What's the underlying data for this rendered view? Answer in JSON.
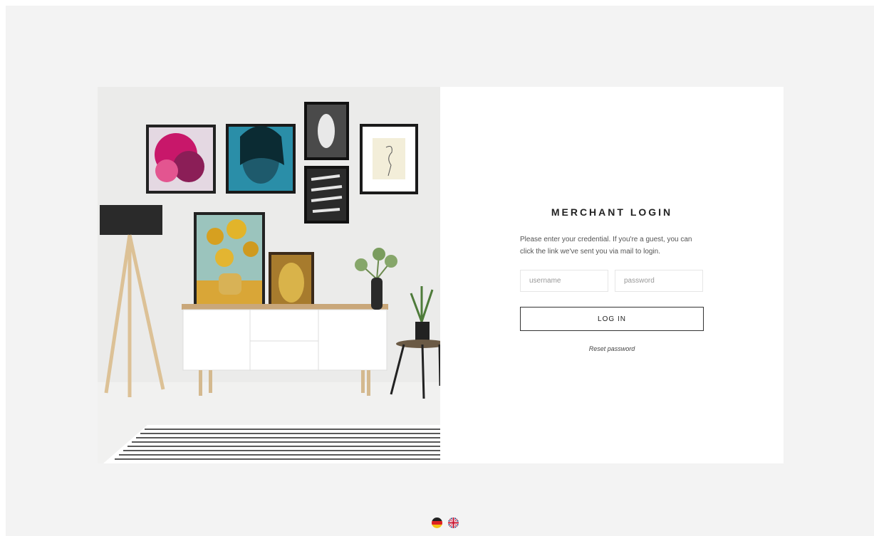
{
  "login": {
    "title": "MERCHANT LOGIN",
    "description": "Please enter your credential. If you're a guest, you can click the link we've sent you via mail to login.",
    "username_placeholder": "username",
    "password_placeholder": "password",
    "login_button": "LOG IN",
    "reset_link": "Reset password"
  },
  "languages": [
    {
      "code": "de",
      "icon": "german-flag-icon"
    },
    {
      "code": "en",
      "icon": "uk-flag-icon"
    }
  ],
  "colors": {
    "page_background": "#f3f3f3",
    "card_background": "#ffffff",
    "button_border": "#333333"
  }
}
